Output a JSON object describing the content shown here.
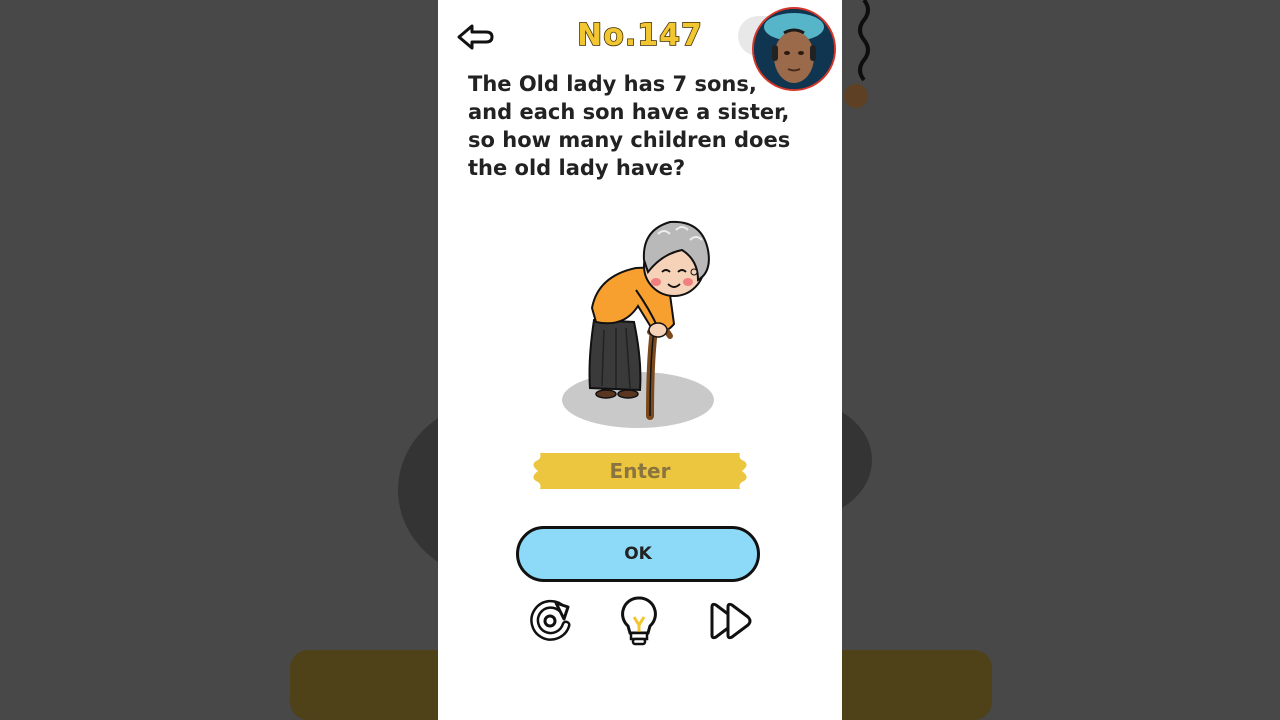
{
  "level": {
    "title": "No.147"
  },
  "question": {
    "text": "The Old lady has 7 sons, and each son have a sister, so how many children does the old lady have?"
  },
  "answer": {
    "placeholder": "Enter",
    "value": ""
  },
  "buttons": {
    "ok_label": "OK"
  },
  "icons": {
    "back": "back-arrow-icon",
    "restart": "restart-icon",
    "hint": "lightbulb-hint-icon",
    "skip": "skip-forward-icon"
  },
  "colors": {
    "title": "#f2c630",
    "ok_button": "#8dd9f8",
    "enter_field": "#ecc63e",
    "shirt": "#f7a030"
  }
}
